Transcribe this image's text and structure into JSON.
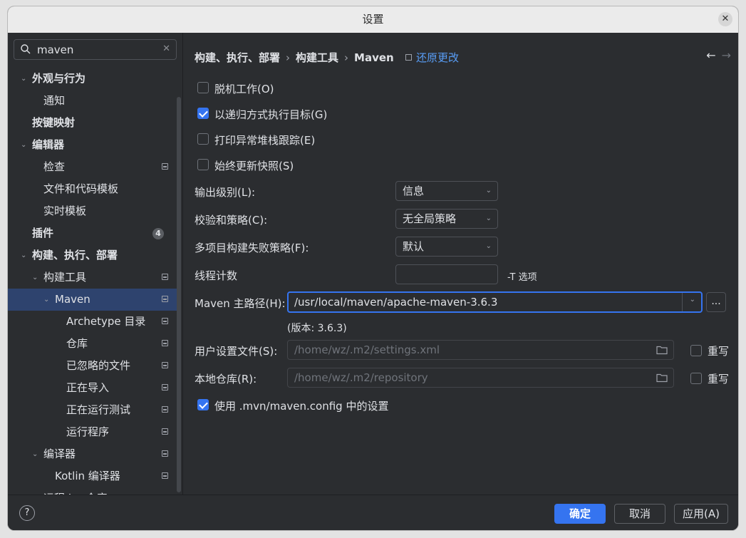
{
  "window": {
    "title": "设置",
    "close_label": "✕"
  },
  "search": {
    "value": "maven",
    "clear_label": "✕"
  },
  "tree": [
    {
      "label": "外观与行为",
      "indent": 0,
      "arrow": "expanded",
      "bold": true
    },
    {
      "label": "通知",
      "indent": 1
    },
    {
      "label": "按键映射",
      "indent": 0,
      "bold": true
    },
    {
      "label": "编辑器",
      "indent": 0,
      "arrow": "expanded",
      "bold": true
    },
    {
      "label": "检查",
      "indent": 1,
      "proj": true
    },
    {
      "label": "文件和代码模板",
      "indent": 1
    },
    {
      "label": "实时模板",
      "indent": 1
    },
    {
      "label": "插件",
      "indent": 0,
      "bold": true,
      "badge": "4"
    },
    {
      "label": "构建、执行、部署",
      "indent": 0,
      "arrow": "expanded",
      "bold": true
    },
    {
      "label": "构建工具",
      "indent": 1,
      "arrow": "expanded",
      "proj": true
    },
    {
      "label": "Maven",
      "indent": 2,
      "arrow": "expanded",
      "proj": true,
      "selected": true
    },
    {
      "label": "Archetype 目录",
      "indent": 3,
      "proj": true
    },
    {
      "label": "仓库",
      "indent": 3,
      "proj": true
    },
    {
      "label": "已忽略的文件",
      "indent": 3,
      "proj": true
    },
    {
      "label": "正在导入",
      "indent": 3,
      "proj": true
    },
    {
      "label": "正在运行测试",
      "indent": 3,
      "proj": true
    },
    {
      "label": "运行程序",
      "indent": 3,
      "proj": true
    },
    {
      "label": "编译器",
      "indent": 1,
      "arrow": "expanded",
      "proj": true
    },
    {
      "label": "Kotlin 编译器",
      "indent": 2,
      "proj": true
    },
    {
      "label": "远程 Jar 仓库",
      "indent": 1,
      "proj": true
    }
  ],
  "breadcrumb": [
    "构建、执行、部署",
    "构建工具",
    "Maven"
  ],
  "breadcrumb_sep": "›",
  "reset_label": "还原更改",
  "nav": {
    "back": "←",
    "forward": "→"
  },
  "checks": [
    {
      "label": "脱机工作(O)",
      "checked": false
    },
    {
      "label": "以递归方式执行目标(G)",
      "checked": true
    },
    {
      "label": "打印异常堆栈跟踪(E)",
      "checked": false
    },
    {
      "label": "始终更新快照(S)",
      "checked": false
    }
  ],
  "fields": {
    "output_level": {
      "label": "输出级别(L):",
      "value": "信息"
    },
    "checksum": {
      "label": "校验和策略(C):",
      "value": "无全局策略"
    },
    "multiproject": {
      "label": "多项目构建失败策略(F):",
      "value": "默认"
    },
    "thread_count": {
      "label": "线程计数",
      "value": "",
      "suffix": "-T 选项"
    },
    "maven_home": {
      "label": "Maven 主路径(H):",
      "value": "/usr/local/maven/apache-maven-3.6.3",
      "browse": "..."
    },
    "version": "(版本: 3.6.3)",
    "user_settings": {
      "label": "用户设置文件(S):",
      "placeholder": "/home/wz/.m2/settings.xml",
      "override": "重写"
    },
    "local_repo": {
      "label": "本地仓库(R):",
      "placeholder": "/home/wz/.m2/repository",
      "override": "重写"
    }
  },
  "use_mvn_config": {
    "label": "使用 .mvn/maven.config 中的设置",
    "checked": true
  },
  "footer": {
    "help": "?",
    "ok": "确定",
    "cancel": "取消",
    "apply": "应用(A)"
  },
  "colors": {
    "accent": "#3574f0",
    "link": "#589df6",
    "bg": "#2b2d30",
    "selected": "#2e436e"
  }
}
